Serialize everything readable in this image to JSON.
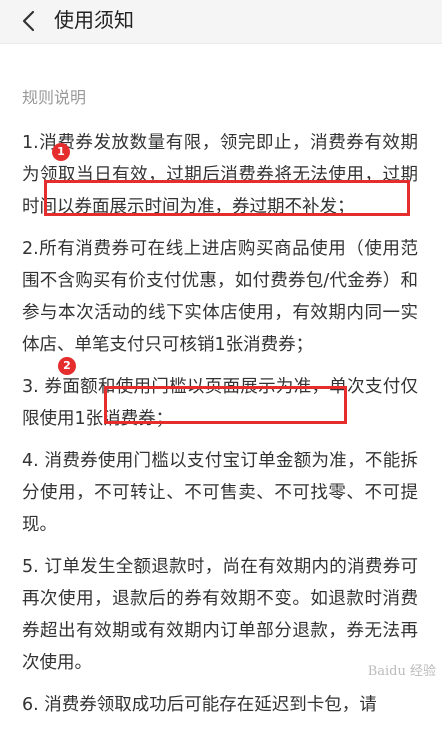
{
  "header": {
    "title": "使用须知"
  },
  "section": {
    "title": "规则说明"
  },
  "rules": [
    "1.消费券发放数量有限，领完即止，消费券有效期为领取当日有效，过期后消费券将无法使用，过期时间以券面展示时间为准，券过期不补发；",
    "2.所有消费券可在线上进店购买商品使用（使用范围不含购买有价支付优惠，如付费券包/代金券）和参与本次活动的线下实体店使用，有效期内同一实体店、单笔支付只可核销1张消费券；",
    "3. 券面额和使用门槛以页面展示为准，单次支付仅限使用1张消费券；",
    "4. 消费券使用门槛以支付宝订单金额为准，不能拆分使用，不可转让、不可售卖、不可找零、不可提现。",
    "5. 订单发生全额退款时，尚在有效期内的消费券可再次使用，退款后的券有效期不变。如退款时消费券超出有效期或有效期内订单部分退款，券无法再次使用。",
    "6. 消费券领取成功后可能存在延迟到卡包，请"
  ],
  "annotations": [
    {
      "label": "1"
    },
    {
      "label": "2"
    }
  ],
  "watermark": "Baidu 经验",
  "colors": {
    "highlight": "#e52d2d",
    "header_bg": "#f5f5f5"
  }
}
